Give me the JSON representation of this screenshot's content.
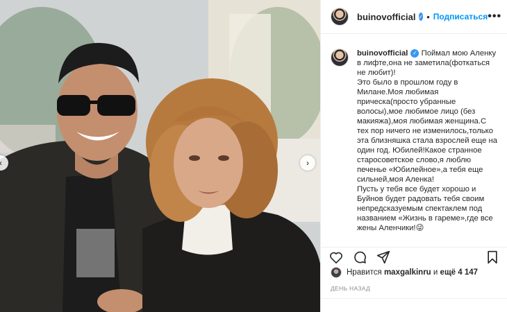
{
  "post": {
    "username": "buinovofficial",
    "verified_symbol": "✓",
    "separator": "•",
    "follow_label": "Подписаться",
    "more_symbol": "•••",
    "caption": "Поймал мою Аленку в лифте,она не заметила(фоткаться не любит)!\nЭто было в прошлом году в Милане.Моя любимая прическа(просто убранные волосы),мое любимое лицо (без макияжа),моя любимая женщина.С тех пор ничего не изменилось,только эта близняшка стала взрослей еще на один год. Юбилей!Какое странное старосоветское слово,я люблю печенье «Юбилейное»,а тебя еще сильней,моя Аленка!\nПусть у тебя все будет хорошо и Буйнов будет радовать тебя своим непредсказуемым спектаклем под названием «Жизнь в гареме»,где все жены Аленчики!",
    "caption_emoji": "😜",
    "likes_prefix": "Нравится",
    "likes_user": "maxgalkinru",
    "likes_middle": "и",
    "likes_count": "ещё 4 147",
    "timestamp": "ДЕНЬ НАЗАД"
  },
  "icons": {
    "like": "heart-icon",
    "comment": "comment-icon",
    "share": "share-icon",
    "save": "bookmark-icon",
    "prev": "chevron-left-icon",
    "next": "chevron-right-icon"
  },
  "colors": {
    "accent": "#0095f6",
    "verified": "#3897f0",
    "text": "#262626",
    "muted": "#8e8e8e"
  },
  "nav": {
    "prev_symbol": "‹",
    "next_symbol": "›"
  }
}
